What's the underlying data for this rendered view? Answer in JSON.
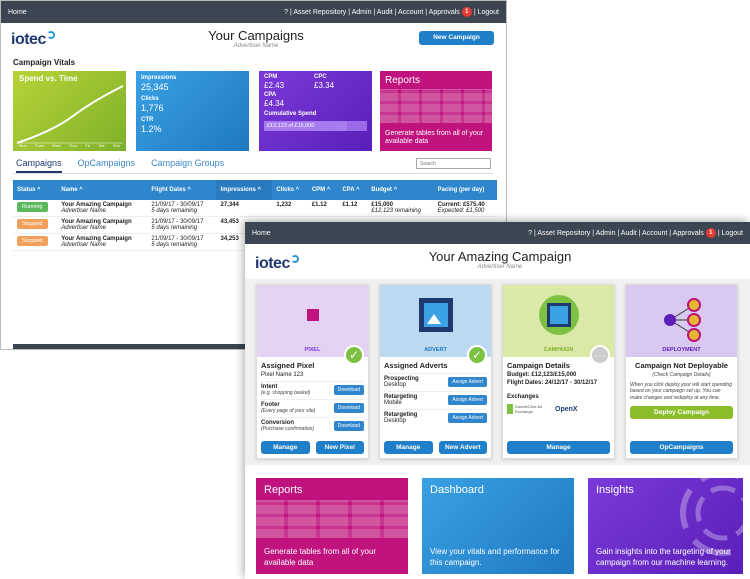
{
  "back": {
    "nav": {
      "home": "Home",
      "links": "? | Asset Repository | Admin | Audit | Account | Approvals",
      "badge": "1",
      "logout": "| Logout"
    },
    "logo": "iotec",
    "title": "Your Campaigns",
    "subtitle": "Advertiser Name",
    "new_campaign": "New Campaign",
    "vitals_title": "Campaign Vitals",
    "spend_tile": {
      "title": "Spend vs. Time",
      "days": [
        "Mon",
        "Tues",
        "Wed",
        "Thur",
        "Fri",
        "Sat",
        "Sun"
      ]
    },
    "stats_tile": {
      "impressions_label": "Impressions",
      "impressions": "25,345",
      "clicks_label": "Clicks",
      "clicks": "1,776",
      "ctr_label": "CTR",
      "ctr": "1.2%"
    },
    "cost_tile": {
      "cpm_label": "CPM",
      "cpm": "£2.43",
      "cpc_label": "CPC",
      "cpc": "£3.34",
      "cpa_label": "CPA",
      "cpa": "£4.34",
      "cum_label": "Cumulative Spend",
      "cum_value": "£12,123 of £15,000",
      "cum_progress": 0.81
    },
    "reports_tile": {
      "title": "Reports",
      "desc": "Generate tables from all of your available data"
    },
    "tabs": [
      "Campaigns",
      "OpCampaigns",
      "Campaign Groups"
    ],
    "search_placeholder": "Search",
    "columns": [
      "Status ^",
      "Name ^",
      "Flight Dates ^",
      "Impressions ^",
      "Clicks ^",
      "CPM ^",
      "CPA ^",
      "Budget ^",
      "Pacing (per day)"
    ],
    "rows": [
      {
        "status": "Running",
        "status_color": "#5cb85c",
        "name": "Your Amazing Campaign",
        "adv": "Advertiser Name",
        "dates": "21/09/17 - 30/09/17",
        "remaining": "5 days remaining",
        "impr": "27,344",
        "clicks": "1,232",
        "cpm": "£1.12",
        "cpa": "£1.12",
        "budget": "£15,000",
        "budget_sub": "£12,123 remaining",
        "pacing": "Current: £575.40",
        "pacing_sub": "Expected: £1,500"
      },
      {
        "status": "Stopped",
        "status_color": "#f0a05a",
        "name": "Your Amazing Campaign",
        "adv": "Advertiser Name",
        "dates": "21/09/17 - 30/09/17",
        "remaining": "5 days remaining",
        "impr": "43,453",
        "clicks": "",
        "cpm": "",
        "cpa": "",
        "budget": "",
        "budget_sub": "",
        "pacing": "",
        "pacing_sub": ""
      },
      {
        "status": "Stopped",
        "status_color": "#f0a05a",
        "name": "Your Amazing Campaign",
        "adv": "Advertiser Name",
        "dates": "21/09/17 - 30/09/17",
        "remaining": "5 days remaining",
        "impr": "34,253",
        "clicks": "",
        "cpm": "",
        "cpa": "",
        "budget": "",
        "budget_sub": "",
        "pacing": "",
        "pacing_sub": ""
      }
    ]
  },
  "front": {
    "nav": {
      "home": "Home",
      "links": "? | Asset Repository | Admin | Audit | Account | Approvals",
      "badge": "1",
      "logout": "| Logout"
    },
    "logo": "iotec",
    "title": "Your Amazing Campaign",
    "subtitle": "Advertiser Name",
    "pixel": {
      "label": "PIXEL",
      "title": "Assigned Pixel",
      "name": "Pixel Name 123",
      "items": [
        {
          "name": "Intent",
          "sub": "(e.g. shopping basket)",
          "btn": "Download"
        },
        {
          "name": "Footer",
          "sub": "(Every page of your site)",
          "btn": "Download"
        },
        {
          "name": "Conversion",
          "sub": "(Purchase confirmation)",
          "btn": "Download"
        }
      ],
      "btn1": "Manage",
      "btn2": "New Pixel"
    },
    "advert": {
      "label": "ADVERT",
      "title": "Assigned Adverts",
      "items": [
        {
          "name": "Prospecting",
          "sub": "Desktop",
          "btn": "Assign Advert"
        },
        {
          "name": "Retargeting",
          "sub": "Mobile",
          "btn": "Assign Advert"
        },
        {
          "name": "Retargeting",
          "sub": "Desktop",
          "btn": "Assign Advert"
        }
      ],
      "btn1": "Manage",
      "btn2": "New Advert"
    },
    "campaign": {
      "label": "CAMPAIGN",
      "title": "Campaign Details",
      "budget": "Budget: £12,123/£15,000",
      "flight": "Flight Dates: 24/12/17 - 30/12/17",
      "exchanges": "Exchanges",
      "ex1": "DoubleClick Ad Exchange",
      "ex2": "OpenX",
      "btn": "Manage"
    },
    "deployment": {
      "label": "DEPLOYMENT",
      "title": "Campaign Not Deployable",
      "sub": "(Check Campaign Details)",
      "desc": "When you click deploy your will start spending based on your campaign set up. You can make changes and redeploy at any time.",
      "deploy": "Deploy Campaign",
      "btn": "OpCampaigns"
    },
    "tiles": {
      "reports": {
        "title": "Reports",
        "desc": "Generate tables from all of your available data"
      },
      "dashboard": {
        "title": "Dashboard",
        "desc": "View your vitals and performance for this campaign."
      },
      "insights": {
        "title": "Insights",
        "desc": "Gain insights into the targeting of your campaign from our machine learning."
      }
    }
  }
}
